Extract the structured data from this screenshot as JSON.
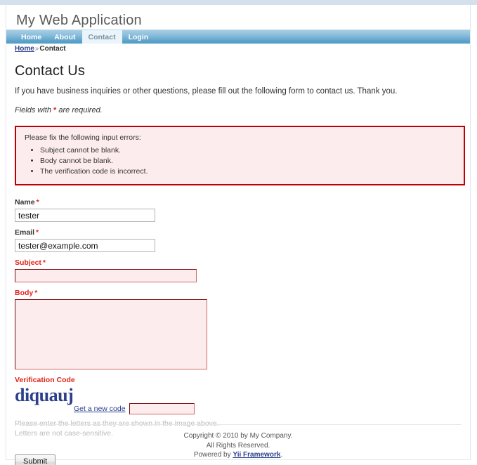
{
  "header": {
    "title": "My Web Application"
  },
  "nav": {
    "items": [
      {
        "label": "Home",
        "active": false
      },
      {
        "label": "About",
        "active": false
      },
      {
        "label": "Contact",
        "active": true
      },
      {
        "label": "Login",
        "active": false
      }
    ]
  },
  "breadcrumb": {
    "home": "Home",
    "separator": "»",
    "current": "Contact"
  },
  "main": {
    "page_title": "Contact Us",
    "intro": "If you have business inquiries or other questions, please fill out the following form to contact us. Thank you.",
    "note_before": "Fields with ",
    "note_star": "*",
    "note_after": " are required."
  },
  "error_summary": {
    "heading": "Please fix the following input errors:",
    "items": [
      "Subject cannot be blank.",
      "Body cannot be blank.",
      "The verification code is incorrect."
    ],
    "border_color": "#c00000",
    "background_color": "#fdeced"
  },
  "form": {
    "name": {
      "label": "Name",
      "required_mark": "*",
      "value": "tester",
      "placeholder": "",
      "error": false
    },
    "email": {
      "label": "Email",
      "required_mark": "*",
      "value": "tester@example.com",
      "placeholder": "",
      "error": false
    },
    "subject": {
      "label": "Subject",
      "required_mark": "*",
      "value": "",
      "placeholder": "",
      "error": true
    },
    "body": {
      "label": "Body",
      "required_mark": "*",
      "value": "",
      "placeholder": "",
      "error": true
    },
    "verification": {
      "label": "Verification Code",
      "captcha_text": "diquauj",
      "captcha_color": "#2b3f8c",
      "refresh_link": "Get a new code",
      "value": "",
      "placeholder": "",
      "hint_line1": "Please enter the letters as they are shown in the image above.",
      "hint_line2": "Letters are not case-sensitive."
    },
    "submit_label": "Submit"
  },
  "footer": {
    "line1": "Copyright © 2010 by My Company.",
    "line2": "All Rights Reserved.",
    "powered_prefix": "Powered by ",
    "powered_link": "Yii Framework",
    "powered_suffix": "."
  }
}
